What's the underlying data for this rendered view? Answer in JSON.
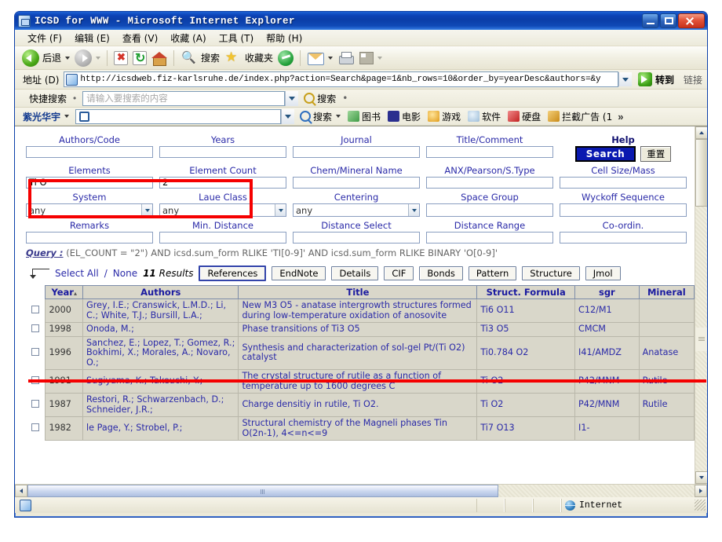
{
  "window": {
    "title": "ICSD for WWW - Microsoft Internet Explorer",
    "minimize_label": "Minimize",
    "maximize_label": "Restore",
    "close_label": "Close"
  },
  "menu": [
    {
      "label": "文件 (F)"
    },
    {
      "label": "编辑 (E)"
    },
    {
      "label": "查看 (V)"
    },
    {
      "label": "收藏 (A)"
    },
    {
      "label": "工具 (T)"
    },
    {
      "label": "帮助 (H)"
    }
  ],
  "toolbar": {
    "back_label": "后退",
    "forward_label": "",
    "stop_label": "",
    "refresh_label": "",
    "home_label": "",
    "search_label": "搜索",
    "favorites_label": "收藏夹",
    "media_label": "",
    "mail_label": "",
    "print_label": "",
    "edit_label": ""
  },
  "address": {
    "label": "地址 (D)",
    "url": "http://icsdweb.fiz-karlsruhe.de/index.php?action=Search&page=1&nb_rows=10&order_by=yearDesc&authors=&y",
    "go_label": "转到",
    "links_label": "链接"
  },
  "quick_search": {
    "brand": "快捷搜索",
    "placeholder": "请输入要搜索的内容",
    "value": "",
    "search_label": "搜索"
  },
  "toolbar2": {
    "brand": "紫光华宇",
    "value": "",
    "search_label": "搜索",
    "links": [
      {
        "label": "图书",
        "icon": "book-icon"
      },
      {
        "label": "电影",
        "icon": "movie-icon"
      },
      {
        "label": "游戏",
        "icon": "game-icon"
      },
      {
        "label": "软件",
        "icon": "software-icon"
      },
      {
        "label": "硬盘",
        "icon": "disk-icon"
      },
      {
        "label": "拦截广告  (1",
        "icon": "adblock-icon"
      }
    ],
    "overflow_label": "»"
  },
  "form": {
    "fields": [
      {
        "label": "Authors/Code",
        "value": "",
        "type": "text"
      },
      {
        "label": "Years",
        "value": "",
        "type": "text"
      },
      {
        "label": "Journal",
        "value": "",
        "type": "text"
      },
      {
        "label": "Title/Comment",
        "value": "",
        "type": "text"
      },
      {
        "label": "Elements",
        "value": "Ti O",
        "type": "text"
      },
      {
        "label": "Element Count",
        "value": "2",
        "type": "text"
      },
      {
        "label": "Chem/Mineral Name",
        "value": "",
        "type": "text"
      },
      {
        "label": "ANX/Pearson/S.Type",
        "value": "",
        "type": "text"
      },
      {
        "label": "Cell Size/Mass",
        "value": "",
        "type": "text"
      },
      {
        "label": "System",
        "value": "any",
        "type": "select"
      },
      {
        "label": "Laue Class",
        "value": "any",
        "type": "select"
      },
      {
        "label": "Centering",
        "value": "any",
        "type": "select"
      },
      {
        "label": "Space Group",
        "value": "",
        "type": "text"
      },
      {
        "label": "Wyckoff Sequence",
        "value": "",
        "type": "text"
      },
      {
        "label": "Remarks",
        "value": "",
        "type": "text"
      },
      {
        "label": "Min. Distance",
        "value": "",
        "type": "text"
      },
      {
        "label": "Distance Select",
        "value": "",
        "type": "text"
      },
      {
        "label": "Distance Range",
        "value": "",
        "type": "text"
      },
      {
        "label": "Co-ordin.",
        "value": "",
        "type": "text"
      }
    ],
    "help_label": "Help",
    "search_button": "Search",
    "reset_button": "重置"
  },
  "query": {
    "prefix": "Query :",
    "text": " (EL_COUNT = \"2\") AND icsd.sum_form RLIKE 'TI[0-9]' AND icsd.sum_form RLIKE BINARY 'O[0-9]'"
  },
  "results_bar": {
    "select_all": "Select All",
    "separator": "/",
    "select_none": "None",
    "count": "11",
    "count_suffix": "Results",
    "buttons": [
      {
        "label": "References"
      },
      {
        "label": "EndNote"
      },
      {
        "label": "Details"
      },
      {
        "label": "CIF"
      },
      {
        "label": "Bonds"
      },
      {
        "label": "Pattern"
      },
      {
        "label": "Structure"
      },
      {
        "label": "Jmol"
      }
    ]
  },
  "table": {
    "columns": [
      "Year",
      "Authors",
      "Title",
      "Struct. Formula",
      "sgr",
      "Mineral"
    ],
    "sort_indicator": "▴",
    "rows": [
      {
        "year": "2000",
        "authors": "Grey, I.E.; Cranswick, L.M.D.; Li, C.; White, T.J.; Bursill, L.A.;",
        "title": "New M3 O5 - anatase intergrowth structures formed during low-temperature oxidation of anosovite",
        "formula": "Ti6 O11",
        "sgr": "C12/M1",
        "mineral": ""
      },
      {
        "year": "1998",
        "authors": "Onoda, M.;",
        "title": "Phase transitions of Ti3 O5",
        "formula": "Ti3 O5",
        "sgr": "CMCM",
        "mineral": ""
      },
      {
        "year": "1996",
        "authors": "Sanchez, E.; Lopez, T.; Gomez, R.; Bokhimi, X.; Morales, A.; Novaro, O.;",
        "title": "Synthesis and characterization of sol-gel Pt/(Ti O2) catalyst",
        "formula": "Ti0.784 O2",
        "sgr": "I41/AMDZ",
        "mineral": "Anatase"
      },
      {
        "year": "1991",
        "authors": "Sugiyama, K.; Takeuchi, Y.;",
        "title": "The crystal structure of rutile as a function of temperature up to 1600 degrees C",
        "formula": "Ti O2",
        "sgr": "P42/MNM",
        "mineral": "Rutile"
      },
      {
        "year": "1987",
        "authors": "Restori, R.; Schwarzenbach, D.; Schneider, J.R.;",
        "title": "Charge densitiy in rutile, Ti O2.",
        "formula": "Ti O2",
        "sgr": "P42/MNM",
        "mineral": "Rutile"
      },
      {
        "year": "1982",
        "authors": "le Page, Y.; Strobel, P.;",
        "title": "Structural chemistry of the Magneli phases Tin O(2n-1), 4<=n<=9",
        "formula": "Ti7 O13",
        "sgr": "I1-",
        "mineral": ""
      }
    ]
  },
  "statusbar": {
    "zone": "Internet"
  },
  "annotation": {
    "color": "#f50000",
    "box_label": "elements-and-count-highlight",
    "line_label": "results-divider-highlight"
  }
}
